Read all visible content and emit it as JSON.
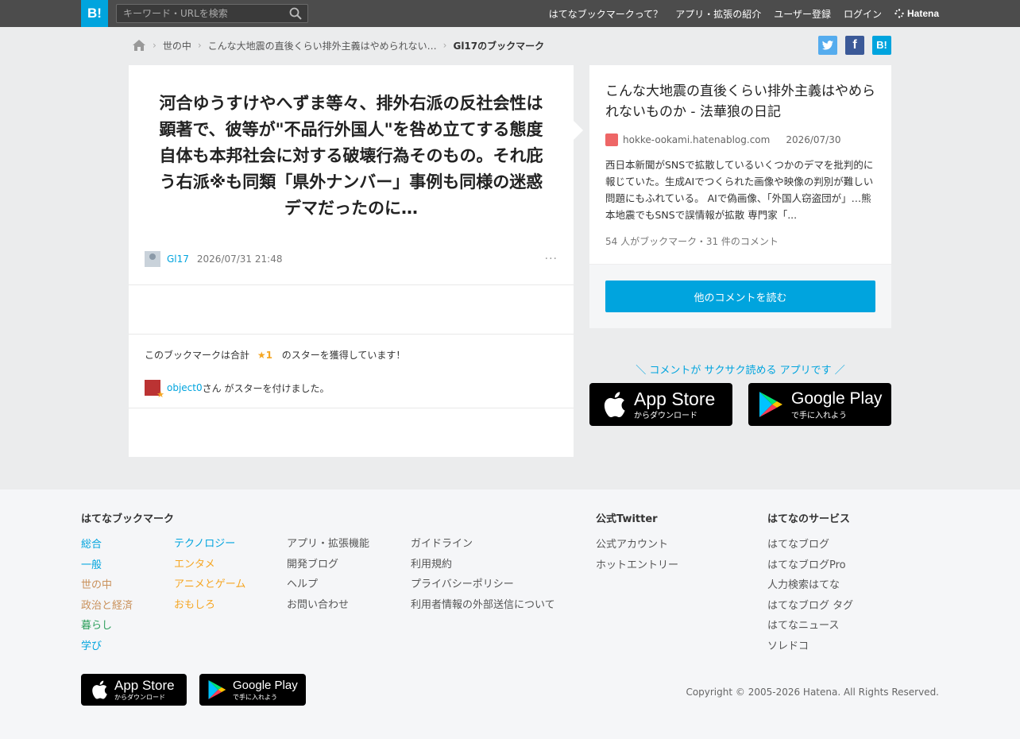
{
  "header": {
    "logo": "B!",
    "search_placeholder": "キーワード・URLを検索",
    "nav": [
      "はてなブックマークって？",
      "アプリ・拡張の紹介",
      "ユーザー登録",
      "ログイン"
    ],
    "brand": "Hatena"
  },
  "breadcrumb": {
    "items": [
      "世の中",
      "こんな大地震の直後くらい排外主義はやめられない…",
      "Gl17のブックマーク"
    ]
  },
  "share": {
    "hatena": "B!"
  },
  "bookmark": {
    "comment": "河合ゆうすけやへずま等々、排外右派の反社会性は顕著で、彼等が\"不品行外国人\"を咎め立てする態度自体も本邦社会に対する破壊行為そのもの。それ庇う右派※も同類「県外ナンバー」事例も同様の迷惑デマだったのに…",
    "user": "Gl17",
    "date": "2026/07/31 21:48",
    "more": "···",
    "star_total_prefix": "このブックマークは合計",
    "star_count": "★1",
    "star_total_suffix": "のスターを獲得しています！",
    "star_giver": "object0",
    "star_giver_suffix": "さん がスターを付けました。"
  },
  "entry": {
    "title": "こんな大地震の直後くらい排外主義はやめられないものか - 法華狼の日記",
    "domain": "hokke-ookami.hatenablog.com",
    "date": "2026/07/30",
    "description": "西日本新聞がSNSで拡散しているいくつかのデマを批判的に報じていた。生成AIでつくられた画像や映像の判別が難しい問題にもふれている。 AIで偽画像、「外国人窃盗団が」…熊本地震でもSNSで誤情報が拡散 専門家「...",
    "count": "54 人がブックマーク・31 件のコメント",
    "read_button": "他のコメントを読む"
  },
  "app_promo": {
    "text": "＼ コメントが サクサク読める アプリです ／",
    "apple_big": "App Store",
    "apple_small": "からダウンロード",
    "google_big": "Google Play",
    "google_small": "で手に入れよう"
  },
  "footer": {
    "col1_heading": "はてなブックマーク",
    "cat1": [
      "総合",
      "一般",
      "世の中",
      "政治と経済",
      "暮らし",
      "学び"
    ],
    "cat2": [
      "テクノロジー",
      "エンタメ",
      "アニメとゲーム",
      "おもしろ"
    ],
    "links1": [
      "アプリ・拡張機能",
      "開発ブログ",
      "ヘルプ",
      "お問い合わせ"
    ],
    "links2": [
      "ガイドライン",
      "利用規約",
      "プライバシーポリシー",
      "利用者情報の外部送信について"
    ],
    "twitter_heading": "公式Twitter",
    "twitter": [
      "公式アカウント",
      "ホットエントリー"
    ],
    "services_heading": "はてなのサービス",
    "services": [
      "はてなブログ",
      "はてなブログPro",
      "人力検索はてな",
      "はてなブログ タグ",
      "はてなニュース",
      "ソレドコ"
    ],
    "copyright": "Copyright © 2005-2026 Hatena. All Rights Reserved."
  }
}
